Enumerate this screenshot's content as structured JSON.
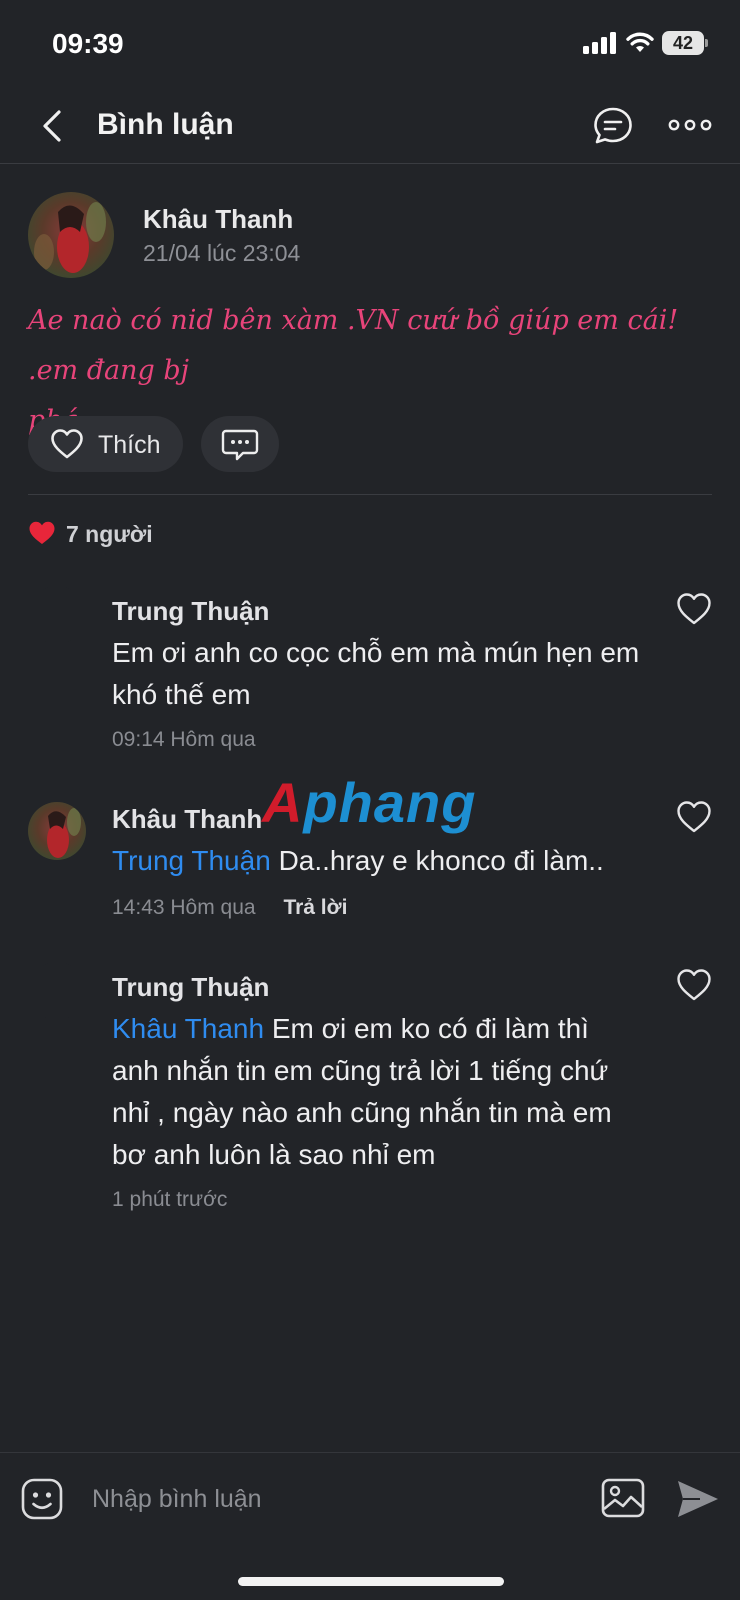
{
  "status_bar": {
    "time": "09:39",
    "battery": "42"
  },
  "nav": {
    "title": "Bình luận",
    "icons": [
      "back-chevron-icon",
      "chat-bubble-icon",
      "more-dots-icon"
    ]
  },
  "post": {
    "author": "Khâu Thanh",
    "time": "21/04 lúc 23:04",
    "text_line1": "Ae naò có nid bên xàm .VN cưứ bồ giúp em cái! .em đang bj",
    "text_line2": "phá",
    "like_label": "Thích",
    "likes_count": "7 người",
    "text_color": "#e8447a"
  },
  "comments": [
    {
      "author": "Trung Thuận",
      "mention": "",
      "text_line1": "Em ơi anh co cọc chỗ em mà mún hẹn em",
      "text_line2": "khó thế em",
      "time": "09:14 Hôm qua",
      "reply_label": ""
    },
    {
      "author": "Khâu Thanh",
      "mention": "Trung Thuận",
      "text_line1": "Da..hray e khonco đi làm..",
      "time": "14:43 Hôm qua",
      "reply_label": "Trả lời"
    },
    {
      "author": "Trung Thuận",
      "mention": "Khâu Thanh",
      "text_line1": "Em ơi em ko có đi làm thì",
      "text_line2": "anh nhắn tin em cũng trả lời 1 tiếng chứ",
      "text_line3": "nhỉ , ngày nào anh cũng nhắn tin mà em",
      "text_line4": "bơ anh luôn là sao nhỉ em",
      "time": "1 phút trước"
    }
  ],
  "watermark": {
    "first": "A",
    "rest": "phang"
  },
  "composer": {
    "placeholder": "Nhập bình luận"
  },
  "colors": {
    "background": "#222428",
    "mention": "#2f8cf0",
    "like_heart": "#e8263a"
  }
}
